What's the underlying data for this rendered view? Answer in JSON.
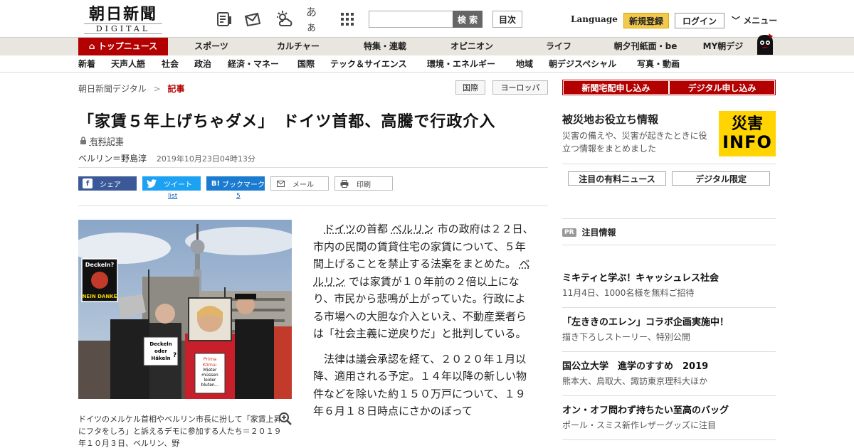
{
  "header": {
    "logo_jp": "朝日新聞",
    "logo_en": "DIGITAL",
    "search_button": "検 索",
    "toc_button": "目次",
    "language": "Language",
    "register": "新規登録",
    "login": "ログイン",
    "menu": "メニュー",
    "font_icon_text": "あぁ"
  },
  "nav_primary": [
    "トップニュース",
    "スポーツ",
    "カルチャー",
    "特集・連載",
    "オピニオン",
    "ライフ",
    "朝夕刊紙面・be",
    "MY朝デジ"
  ],
  "nav_secondary": [
    "新着",
    "天声人語",
    "社会",
    "政治",
    "経済・マネー",
    "国際",
    "テック＆サイエンス",
    "環境・エネルギー",
    "地域",
    "朝デジスペシャル",
    "写真・動画"
  ],
  "breadcrumb": {
    "home": "朝日新聞デジタル",
    "sep": ">",
    "current": "記事"
  },
  "tags": [
    "国際",
    "ヨーロッパ"
  ],
  "article": {
    "title": "「家賃５年上げちゃダメ」　ドイツ首都、高騰で行政介入",
    "paid_label": "有料記事",
    "byline": "ベルリン＝野島淳",
    "datetime": "2019年10月23日04時13分",
    "caption": "ドイツのメルケル首相やベルリン市長に扮して「家賃上昇にフタをしろ」と訴えるデモに参加する人たち＝２０１９年１０月３日、ベルリン、野",
    "p1_link1": "ドイツ",
    "p1_t1": "の首都",
    "p1_link2": "ベルリン",
    "p1_t2": "市の政府は２２日、市内の民間の賃貸住宅の家賃について、５年間上げることを禁止する法案をまとめた。",
    "p1_link3": "ベルリン",
    "p1_t3": "では家賃が１０年前の２倍以上になり、市民から悲鳴が上がっていた。行政による市場への大胆な介入といえ、不動産業者らは「社会主義に逆戻りだ」と批判している。",
    "p2": "法律は議会承認を経て、２０２０年１月以降、適用される予定。１４年以降の新しい物件などを除いた約１５０万戸について、１９年６月１８日時点にさかのぼって"
  },
  "photo_signs": {
    "s1": "Deckeln?",
    "s1b": "NEIN DANKE",
    "s2a": "Deckeln",
    "s2b": "oder",
    "s2c": "Häkeln",
    "s2d": "?",
    "s3a": "Prima",
    "s3b": "Klima:",
    "s3c": "Mieter müssen leider bluten..."
  },
  "share": {
    "facebook": "シェア",
    "twitter": "ツイート",
    "hatena": "ブックマーク",
    "mail": "メール",
    "print": "印刷",
    "tweet_count": "list",
    "hatena_count": "5"
  },
  "sidebar": {
    "apply1": "新聞宅配申し込み",
    "apply2": "デジタル申し込み",
    "disaster_title": "被災地お役立ち情報",
    "disaster_desc": "災害の備えや、災害が起きたときに役立つ情報をまとめました",
    "info_a": "災害",
    "info_b": "INFO",
    "btn1": "注目の有料ニュース",
    "btn2": "デジタル限定",
    "pr_badge": "PR",
    "pr_title": "注目情報",
    "promos": [
      {
        "h": "ミキティと学ぶ！キャッシュレス社会",
        "d": "11月4日、1000名様を無料ご招待"
      },
      {
        "h": "「左ききのエレン」コラボ企画実施中！",
        "d": "描き下ろしストーリー、特別公開"
      },
      {
        "h": "国公立大学　進学のすすめ　2019",
        "d": "熊本大、鳥取大、諏訪東京理科大ほか"
      },
      {
        "h": "オン・オフ問わず持ちたい至高のバッグ",
        "d": "ポール・スミス新作レザーグッズに注目"
      }
    ]
  },
  "colors": {
    "brand_red": "#b30000",
    "accent_yellow": "#f2c94c",
    "facebook": "#3b5998",
    "twitter": "#1da1f2"
  }
}
